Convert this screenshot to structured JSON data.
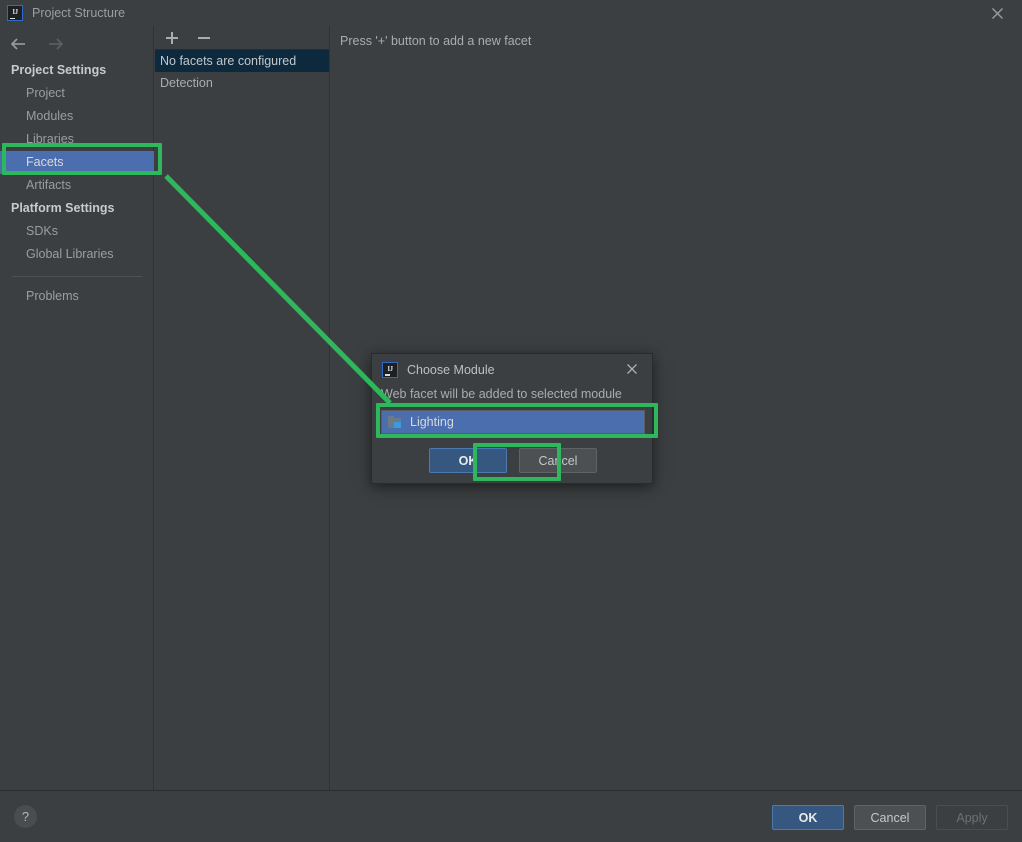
{
  "window": {
    "title": "Project Structure",
    "logo_text": "IJ",
    "close_icon": "close-icon"
  },
  "nav": {
    "back_icon": "arrow-left-icon",
    "forward_icon": "arrow-right-icon"
  },
  "sidebar": {
    "groups": [
      {
        "title": "Project Settings",
        "items": [
          {
            "label": "Project",
            "selected": false
          },
          {
            "label": "Modules",
            "selected": false
          },
          {
            "label": "Libraries",
            "selected": false
          },
          {
            "label": "Facets",
            "selected": true
          },
          {
            "label": "Artifacts",
            "selected": false
          }
        ]
      },
      {
        "title": "Platform Settings",
        "items": [
          {
            "label": "SDKs",
            "selected": false
          },
          {
            "label": "Global Libraries",
            "selected": false
          }
        ]
      }
    ],
    "problems": {
      "label": "Problems",
      "selected": false
    }
  },
  "facet_panel": {
    "add_button_label": "+",
    "remove_button_label": "−",
    "rows": [
      {
        "label": "No facets are configured",
        "selected": true
      },
      {
        "label": "Detection",
        "selected": false
      }
    ]
  },
  "main": {
    "hint": "Press '+' button to add a new facet"
  },
  "dialog": {
    "title": "Choose Module",
    "logo_text": "IJ",
    "description": "Web facet will be added to selected module",
    "modules": [
      {
        "label": "Lighting",
        "icon": "module-folder-icon",
        "selected": true
      }
    ],
    "ok_label": "OK",
    "cancel_label": "Cancel",
    "close_icon": "close-icon"
  },
  "footer": {
    "help_label": "?",
    "ok_label": "OK",
    "cancel_label": "Cancel",
    "apply_label": "Apply",
    "apply_disabled": true
  },
  "annotations": {
    "highlight_color": "#2eb85c",
    "targets": [
      "sidebar-item-facets",
      "dialog-module-list",
      "dialog-ok-button"
    ]
  },
  "colors": {
    "window_bg": "#3c3f41",
    "selection_blue": "#4b6eaf",
    "list_selection_navy": "#0d293e",
    "primary_button": "#365880",
    "accent_green": "#2eb85c"
  }
}
